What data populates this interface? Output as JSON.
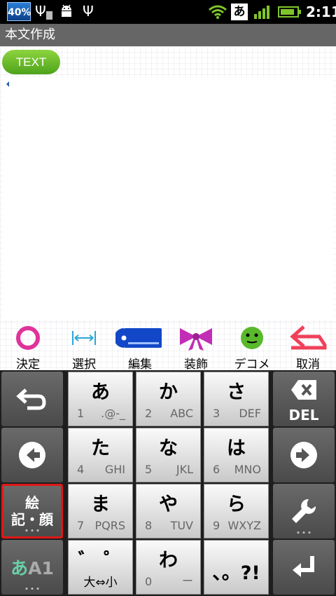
{
  "status_bar": {
    "battery_percent": "40%",
    "ime_indicator": "あ",
    "time": "2:11",
    "battery_level": 0.85,
    "icons": [
      "usb-icon",
      "sd-card-icon",
      "android-debug-icon",
      "usb-icon",
      "wifi-icon",
      "signal-icon",
      "battery-icon"
    ]
  },
  "title_bar": {
    "title": "本文作成"
  },
  "editor": {
    "mode_label": "TEXT"
  },
  "action_bar": {
    "items": [
      {
        "label": "決定",
        "icon": "ring-icon",
        "color": "#e0339a"
      },
      {
        "label": "選択",
        "icon": "select-range-icon",
        "color": "#2aa6d6"
      },
      {
        "label": "編集",
        "icon": "tag-edit-icon",
        "color": "#1248c7"
      },
      {
        "label": "装飾",
        "icon": "ribbon-icon",
        "color": "#c22db5"
      },
      {
        "label": "デコメ",
        "icon": "smiley-icon",
        "color": "#59b82c"
      },
      {
        "label": "取消",
        "icon": "undo-arrow-icon",
        "color": "#f0405a"
      }
    ]
  },
  "keyboard": {
    "keys": [
      {
        "kana": "あ",
        "num": "1",
        "sub": ".@-_"
      },
      {
        "kana": "か",
        "num": "2",
        "sub": "ABC"
      },
      {
        "kana": "さ",
        "num": "3",
        "sub": "DEF"
      },
      {
        "kana": "た",
        "num": "4",
        "sub": "GHI"
      },
      {
        "kana": "な",
        "num": "5",
        "sub": "JKL"
      },
      {
        "kana": "は",
        "num": "6",
        "sub": "MNO"
      },
      {
        "kana": "ま",
        "num": "7",
        "sub": "PQRS"
      },
      {
        "kana": "や",
        "num": "8",
        "sub": "TUV"
      },
      {
        "kana": "ら",
        "num": "9",
        "sub": "WXYZ"
      },
      {
        "kana": "゛ ゜",
        "num": "",
        "sub": "",
        "bottom": "大⇔小"
      },
      {
        "kana": "わ",
        "num": "0",
        "sub": "ー"
      },
      {
        "kana": "、。?!",
        "num": "",
        "sub": ""
      }
    ],
    "emoji_key": {
      "line1": "絵",
      "line2": "記・顔"
    },
    "delete_label": "DEL",
    "mode_key": {
      "kana": "あ",
      "alpha": "A",
      "num": "1"
    },
    "accent_color": "#e01818"
  }
}
